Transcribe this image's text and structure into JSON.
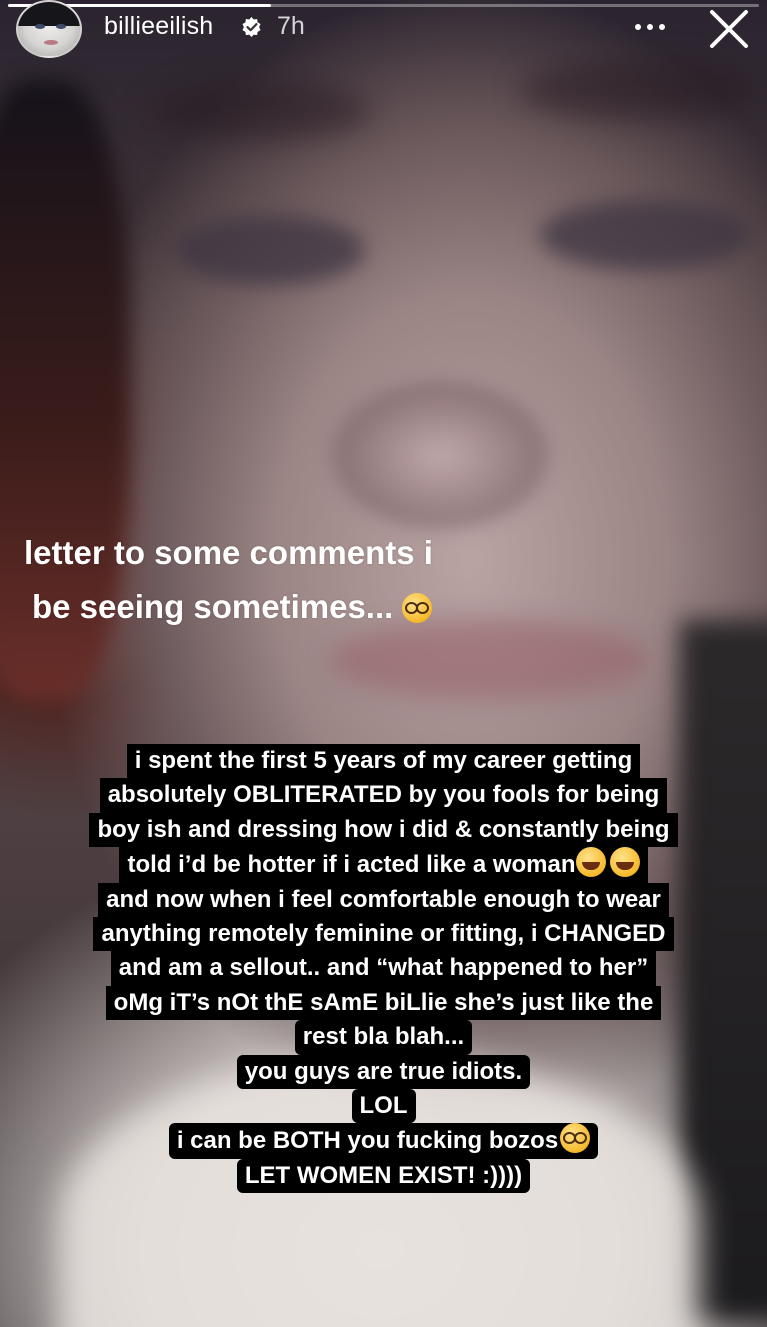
{
  "header": {
    "username": "billieeilish",
    "time": "7h",
    "avatar_icon": "profile-avatar",
    "verified_icon": "verified-badge-icon",
    "more_icon": "more-options-icon",
    "close_icon": "close-icon",
    "story_progress": 0.35
  },
  "caption": {
    "line1": "letter to some comments i",
    "line2": "be seeing sometimes...",
    "emoji": "nerd-face-emoji"
  },
  "message": {
    "lines": [
      "i spent the first 5 years of my career getting",
      "absolutely OBLITERATED by you fools for being",
      "boy ish and dressing how i did & constantly being",
      "told i’d be hotter if i acted like a woman",
      "and now when i feel comfortable enough to wear",
      "anything remotely feminine or fitting, i CHANGED",
      "and am a sellout.. and “what happened to her”",
      "oMg iT’s nOt thE sAmE biLlie she’s just like the",
      "rest bla blah...",
      "you guys are true idiots.",
      "LOL",
      "i can be BOTH you fucking bozos",
      "LET WOMEN EXIST! :))))"
    ],
    "emoji_laugh": "rolling-on-floor-laughing-emoji",
    "emoji_nerd": "nerd-face-emoji"
  },
  "colors": {
    "text": "#ffffff",
    "text_background": "#000000"
  }
}
